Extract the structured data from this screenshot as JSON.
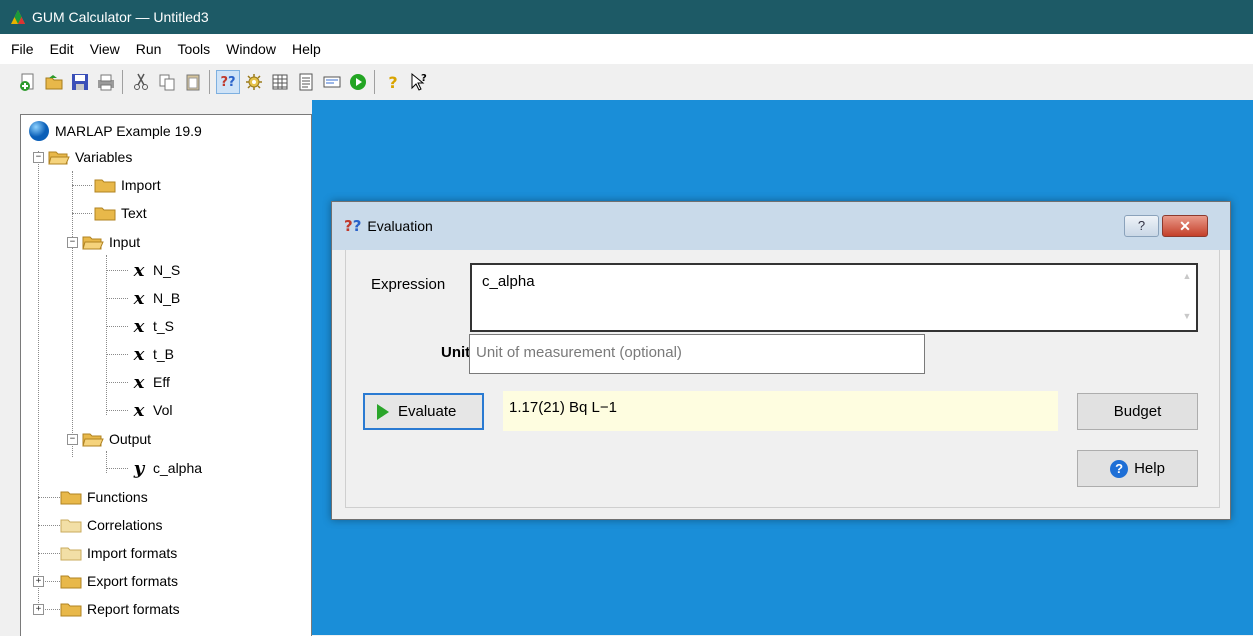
{
  "window": {
    "title": "GUM Calculator — Untitled3"
  },
  "menu": [
    "File",
    "Edit",
    "View",
    "Run",
    "Tools",
    "Window",
    "Help"
  ],
  "toolbar": {
    "icons": [
      "new-icon",
      "open-icon",
      "save-icon",
      "print-icon",
      "cut-icon",
      "copy-icon",
      "paste-icon",
      "evaluate-icon",
      "settings-icon",
      "table-icon",
      "document-icon",
      "panel-icon",
      "run-icon",
      "help-icon",
      "context-help-icon"
    ]
  },
  "tree": {
    "root": "MARLAP Example 19.9",
    "variables": "Variables",
    "import": "Import",
    "text": "Text",
    "input": "Input",
    "inputs": [
      "N_S",
      "N_B",
      "t_S",
      "t_B",
      "Eff",
      "Vol"
    ],
    "output": "Output",
    "outputs": [
      "c_alpha"
    ],
    "functions": "Functions",
    "correlations": "Correlations",
    "import_formats": "Import formats",
    "export_formats": "Export formats",
    "report_formats": "Report formats",
    "input_symbol": "x",
    "output_symbol": "y"
  },
  "dialog": {
    "title": "Evaluation",
    "title_icon": "??",
    "help_title_button": "?",
    "close_button": "✕",
    "expression_label": "Expression",
    "expression_value": "c_alpha",
    "unit_label": "Unit",
    "unit_placeholder": "Unit of measurement (optional)",
    "evaluate_label": "Evaluate",
    "result_value": "1.17(21) Bq L−1",
    "budget_label": "Budget",
    "help_label": "Help",
    "help_icon_glyph": "?"
  }
}
